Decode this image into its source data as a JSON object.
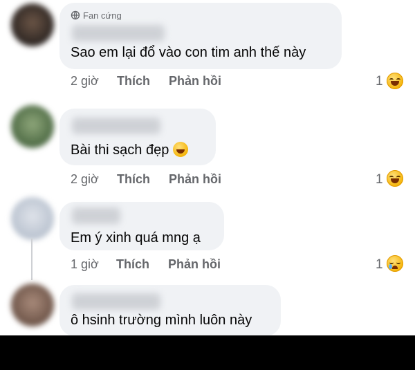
{
  "comments": [
    {
      "badge": "Fan cứng",
      "text": "Sao em lại đổ vào con tim anh thế này",
      "time": "2 giờ",
      "like": "Thích",
      "reply": "Phản hồi",
      "reaction_count": "1",
      "reaction": "laugh"
    },
    {
      "text": "Bài thi sạch đẹp",
      "time": "2 giờ",
      "like": "Thích",
      "reply": "Phản hồi",
      "reaction_count": "1",
      "reaction": "laugh"
    },
    {
      "text": "Em ý xinh quá mng ạ",
      "time": "1 giờ",
      "like": "Thích",
      "reply": "Phản hồi",
      "reaction_count": "1",
      "reaction": "sad"
    },
    {
      "text": "ô hsinh trường mình luôn này"
    }
  ],
  "colors": {
    "bubble": "#f0f2f5",
    "meta_text": "#65676b",
    "text": "#050505"
  }
}
